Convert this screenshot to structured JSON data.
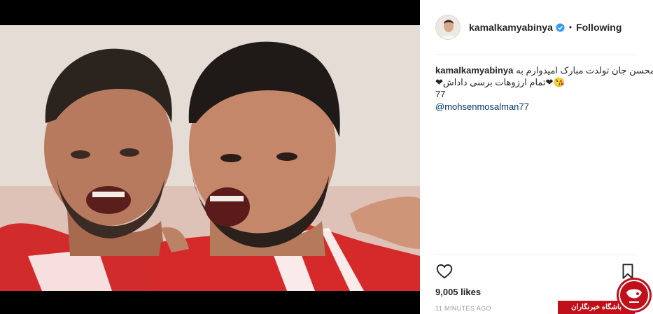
{
  "post": {
    "username": "kamalkamyabinya",
    "separator": "•",
    "follow_status": "Following",
    "caption_line1": "محسن جان تولدت مبارک امیدوارم به",
    "caption_line2": "😘❤تمام ارزوهات برسی داداش❤77",
    "mention": "@mohsenmosalman77",
    "likes": "9,005 likes",
    "time": "11 MINUTES AGO"
  },
  "icons": {
    "verified": "verified-badge-icon",
    "like": "heart-outline-icon",
    "save": "bookmark-icon",
    "watermark": "tv-logo-icon"
  },
  "watermark": {
    "label": "باشگاه خبرنگاران"
  },
  "colors": {
    "verified": "#3897f0",
    "mention": "#003569",
    "watermark_red": "#c0111b",
    "jersey_red": "#d62a2a"
  }
}
